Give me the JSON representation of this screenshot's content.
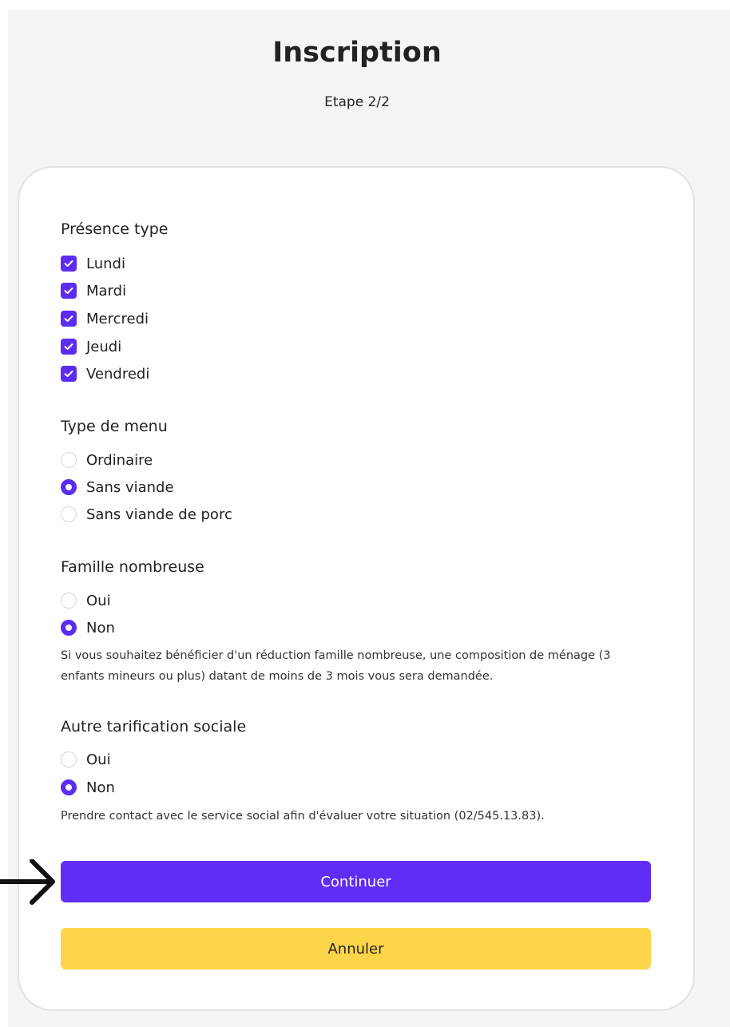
{
  "header": {
    "title": "Inscription",
    "step": "Etape 2/2"
  },
  "presence": {
    "label": "Présence type",
    "options": [
      {
        "label": "Lundi",
        "checked": true
      },
      {
        "label": "Mardi",
        "checked": true
      },
      {
        "label": "Mercredi",
        "checked": true
      },
      {
        "label": "Jeudi",
        "checked": true
      },
      {
        "label": "Vendredi",
        "checked": true
      }
    ]
  },
  "menu_type": {
    "label": "Type de menu",
    "options": [
      {
        "label": "Ordinaire",
        "selected": false
      },
      {
        "label": "Sans viande",
        "selected": true
      },
      {
        "label": "Sans viande de porc",
        "selected": false
      }
    ]
  },
  "large_family": {
    "label": "Famille nombreuse",
    "options": [
      {
        "label": "Oui",
        "selected": false
      },
      {
        "label": "Non",
        "selected": true
      }
    ],
    "note": "Si vous souhaitez bénéficier d'un réduction famille nombreuse, une composition de ménage (3 enfants mineurs ou plus) datant de moins de 3 mois vous sera demandée."
  },
  "social_pricing": {
    "label": "Autre tarification sociale",
    "options": [
      {
        "label": "Oui",
        "selected": false
      },
      {
        "label": "Non",
        "selected": true
      }
    ],
    "note": "Prendre contact avec le service social afin d'évaluer votre situation (02/545.13.83)."
  },
  "actions": {
    "continue_label": "Continuer",
    "cancel_label": "Annuler"
  },
  "colors": {
    "accent": "#5f2df5",
    "cancel": "#fdd54a",
    "background": "#f5f5f5"
  },
  "icons": {
    "checkbox_checked": "check-icon",
    "pointer_arrow": "arrow-right-icon"
  }
}
